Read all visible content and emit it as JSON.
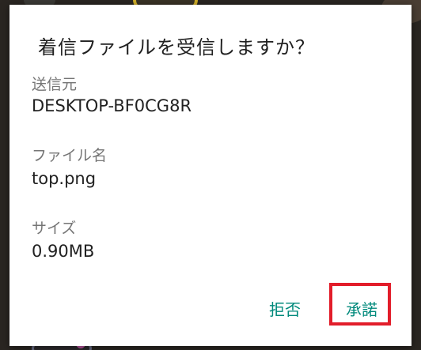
{
  "dialog": {
    "title": "着信ファイルを受信しますか？",
    "fields": [
      {
        "label": "送信元",
        "value": "DESKTOP-BF0CG8R"
      },
      {
        "label": "ファイル名",
        "value": "top.png"
      },
      {
        "label": "サイズ",
        "value": "0.90MB"
      }
    ],
    "buttons": {
      "reject_label": "拒否",
      "accept_label": "承諾"
    }
  },
  "colors": {
    "accent": "#00897b",
    "highlight_border": "#e21d2a",
    "title_text": "#212121",
    "label_text": "#757575",
    "dialog_background": "#ffffff"
  }
}
